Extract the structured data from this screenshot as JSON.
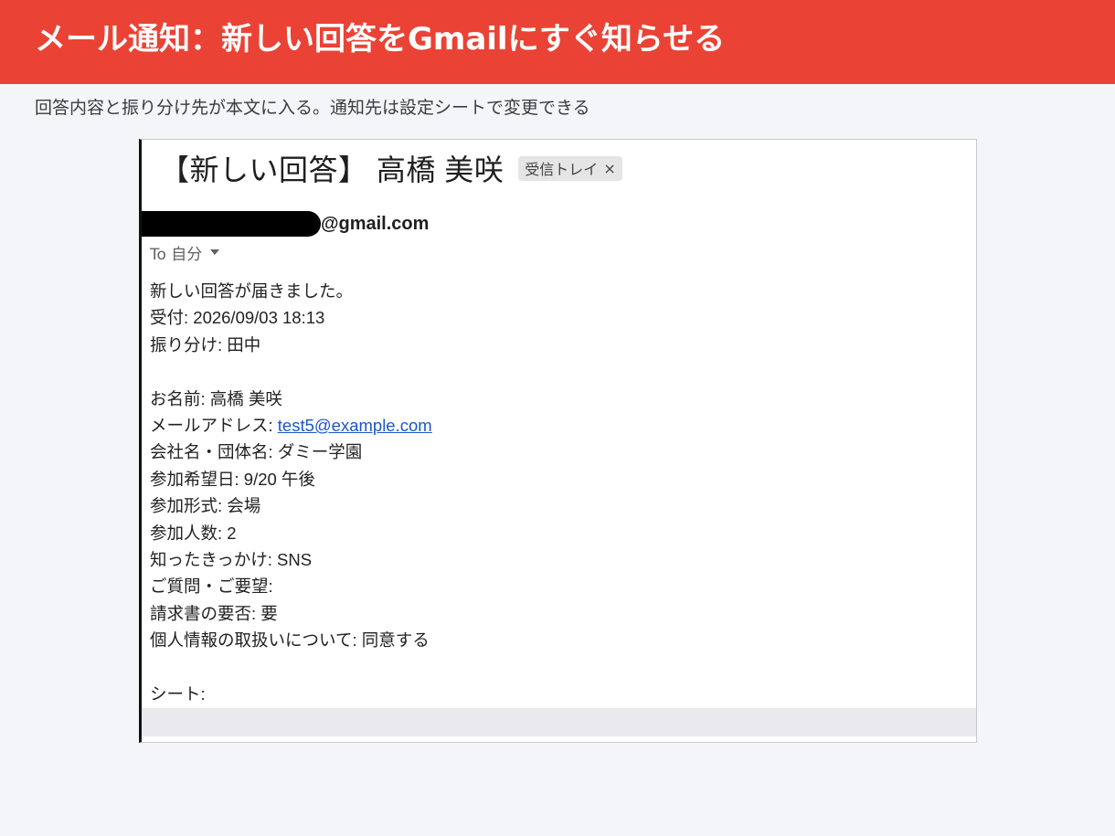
{
  "header": {
    "title": "メール通知：新しい回答をGmailにすぐ知らせる",
    "color": "#ea4335"
  },
  "subtitle": "回答内容と振り分け先が本文に入る。通知先は設定シートで変更できる",
  "email": {
    "subject": "【新しい回答】 高橋 美咲",
    "label": "受信トレイ",
    "label_close": "×",
    "sender_domain": "@gmail.com",
    "to_line": "To 自分",
    "body": {
      "line1": "新しい回答が届きました。",
      "line2": "受付: 2026/09/03 18:13",
      "line3": "振り分け: 田中",
      "name": "お名前: 高橋 美咲",
      "email_label": "メールアドレス: ",
      "email_value": "test5@example.com",
      "company": "会社名・団体名: ダミー学園",
      "date": "参加希望日: 9/20 午後",
      "format": "参加形式: 会場",
      "count": "参加人数: 2",
      "trigger": "知ったきっかけ: SNS",
      "questions": "ご質問・ご要望:",
      "invoice": "請求書の要否: 要",
      "privacy": "個人情報の取扱いについて: 同意する",
      "sheet": "シート:"
    }
  }
}
